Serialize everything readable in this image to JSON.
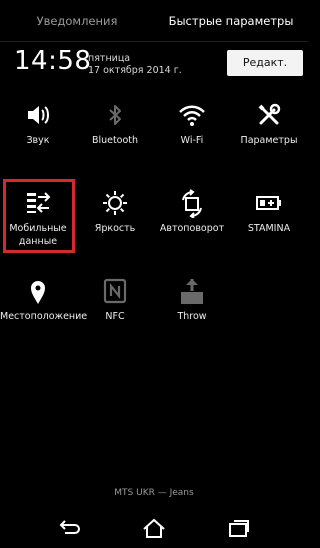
{
  "tabs": {
    "notifications": "Уведомления",
    "quick_settings": "Быстрые параметры"
  },
  "header": {
    "time": "14:58",
    "weekday": "пятница",
    "date": "17 октября 2014 г.",
    "edit_label": "Редакт."
  },
  "tiles": [
    {
      "label": "Звук",
      "icon": "volume-icon"
    },
    {
      "label": "Bluetooth",
      "icon": "bluetooth-icon"
    },
    {
      "label": "Wi-Fi",
      "icon": "wifi-icon"
    },
    {
      "label": "Параметры",
      "icon": "settings-tools-icon"
    },
    {
      "label": "Мобильные данные",
      "icon": "mobile-data-icon"
    },
    {
      "label": "Яркость",
      "icon": "brightness-icon"
    },
    {
      "label": "Автоповорот",
      "icon": "auto-rotate-icon"
    },
    {
      "label": "STAMINA",
      "icon": "battery-stamina-icon"
    },
    {
      "label": "Местоположение",
      "icon": "location-icon"
    },
    {
      "label": "NFC",
      "icon": "nfc-icon"
    },
    {
      "label": "Throw",
      "icon": "throw-icon"
    }
  ],
  "carrier": "MTS UKR — Jeans",
  "navbar": {
    "back": "back-icon",
    "home": "home-icon",
    "recents": "recents-icon"
  },
  "colors": {
    "background": "#000000",
    "highlight": "#d32b2b",
    "edit_button": "#f3f3f3"
  }
}
